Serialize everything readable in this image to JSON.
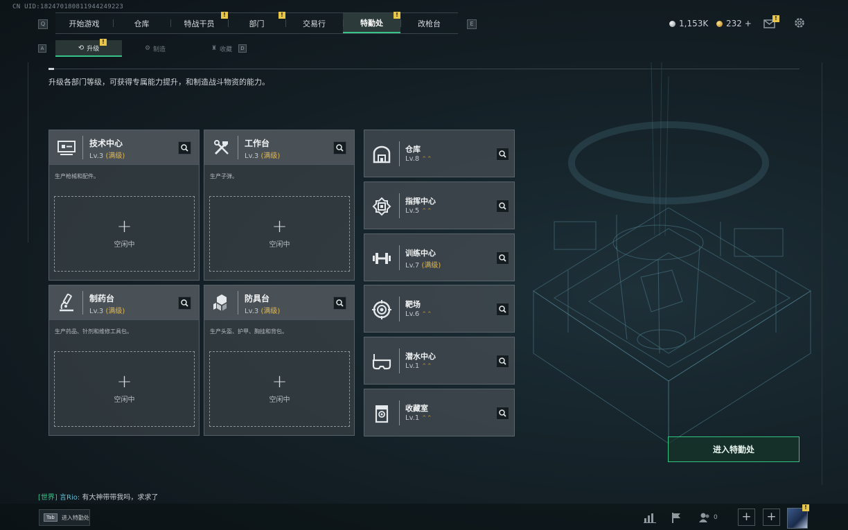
{
  "uid": "CN UID:1824701808119442​49223",
  "top_nav": {
    "left_key": "Q",
    "right_key": "E",
    "tabs": [
      {
        "label": "开始游戏",
        "badge": ""
      },
      {
        "label": "仓库",
        "badge": ""
      },
      {
        "label": "特战干员",
        "badge": "!"
      },
      {
        "label": "部门",
        "badge": "!"
      },
      {
        "label": "交易行",
        "badge": ""
      },
      {
        "label": "特勤处",
        "badge": "!",
        "active": true
      },
      {
        "label": "改枪台",
        "badge": ""
      }
    ]
  },
  "currency": {
    "silver": "1,153K",
    "gold": "232 +"
  },
  "mail_badge": "!",
  "sub_nav": {
    "left_key": "A",
    "right_key": "D",
    "tabs": [
      {
        "label": "升级",
        "icon": "upgrade-icon",
        "active": true,
        "badge": "!"
      },
      {
        "label": "制造",
        "icon": "craft-icon"
      },
      {
        "label": "收藏",
        "icon": "collection-icon"
      }
    ]
  },
  "description": "升级各部门等级，可获得专属能力提升，和制造战斗物资的能力。",
  "idle_label": "空闲中",
  "stations": [
    {
      "name": "技术中心",
      "level": "Lv.3",
      "max": "(满级)",
      "desc": "生产枪械和配件。",
      "icon": "tech-center-icon"
    },
    {
      "name": "工作台",
      "level": "Lv.3",
      "max": "(满级)",
      "desc": "生产子弹。",
      "icon": "workbench-icon"
    },
    {
      "name": "制药台",
      "level": "Lv.3",
      "max": "(满级)",
      "desc": "生产药品、针剂和维修工具包。",
      "icon": "pharmacy-icon"
    },
    {
      "name": "防具台",
      "level": "Lv.3",
      "max": "(满级)",
      "desc": "生产头盔、护甲、胸挂和背包。",
      "icon": "armor-icon"
    }
  ],
  "facilities": [
    {
      "name": "仓库",
      "level": "Lv.8",
      "max": "",
      "up": "⌃⌃",
      "icon": "warehouse-icon"
    },
    {
      "name": "指挥中心",
      "level": "Lv.5",
      "max": "",
      "up": "⌃⌃",
      "icon": "command-center-icon"
    },
    {
      "name": "训练中心",
      "level": "Lv.7",
      "max": "(满级)",
      "up": "",
      "icon": "training-icon"
    },
    {
      "name": "靶场",
      "level": "Lv.6",
      "max": "",
      "up": "⌃⌃",
      "icon": "range-icon"
    },
    {
      "name": "潜水中心",
      "level": "Lv.1",
      "max": "",
      "up": "⌃⌃",
      "icon": "diving-icon"
    },
    {
      "name": "收藏室",
      "level": "Lv.1",
      "max": "",
      "up": "⌃⌃",
      "icon": "collection-room-icon"
    }
  ],
  "enter_button": "进入特勤处",
  "chat": {
    "channel": "[世界]",
    "sender": "言Rio:",
    "message": "有大神带带我吗，求求了"
  },
  "tab_hint": {
    "key": "Tab",
    "label": "进入特勤处"
  },
  "bottom": {
    "friends_count": "0",
    "avatar_badge": "!"
  },
  "colors": {
    "accent": "#37c48a",
    "badge": "#e8c64a",
    "max_level": "#e2b84a"
  }
}
